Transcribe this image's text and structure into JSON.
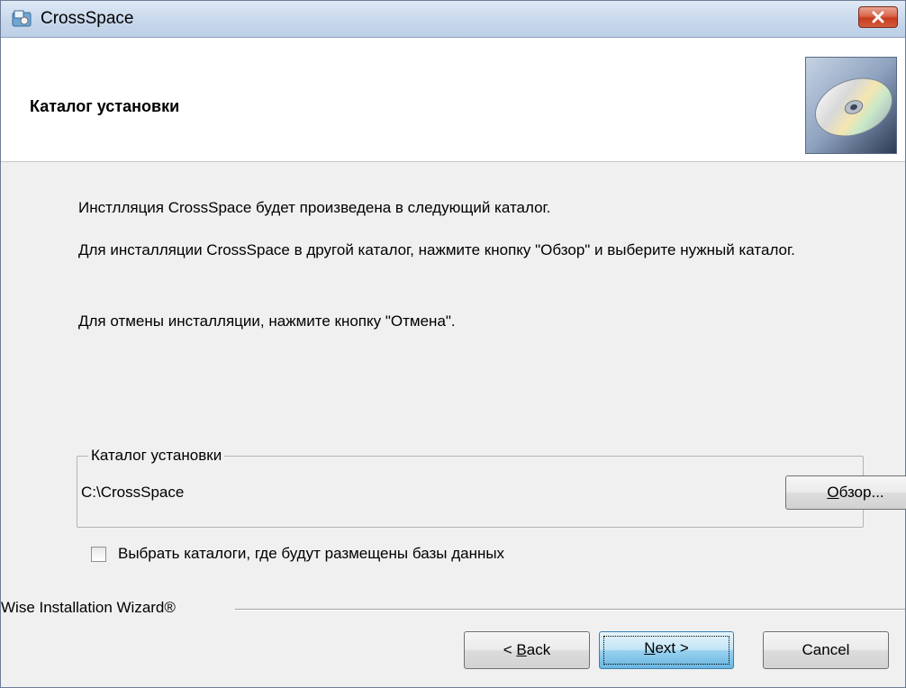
{
  "window": {
    "title": "CrossSpace"
  },
  "header": {
    "heading": "Каталог установки",
    "image_icon": "cd-disc-icon"
  },
  "body": {
    "line1": "Инстлляция CrossSpace будет произведена в следующий каталог.",
    "line2": "Для инсталляции CrossSpace в другой каталог, нажмите кнопку \"Обзор\" и выберите нужный каталог.",
    "line3": "Для отмены инсталляции, нажмите кнопку \"Отмена\"."
  },
  "destination": {
    "group_label": "Каталог установки",
    "path": "C:\\CrossSpace",
    "browse_label_prefix": "О",
    "browse_label_rest": "бзор..."
  },
  "options": {
    "select_db_dirs_label": "Выбрать каталоги, где будут размещены базы данных",
    "select_db_dirs_checked": false
  },
  "footer": {
    "brand": "Wise Installation Wizard®",
    "back_prefix": "< ",
    "back_mnemonic": "B",
    "back_rest": "ack",
    "next_mnemonic": "N",
    "next_rest": "ext >",
    "cancel_label": "Cancel"
  }
}
